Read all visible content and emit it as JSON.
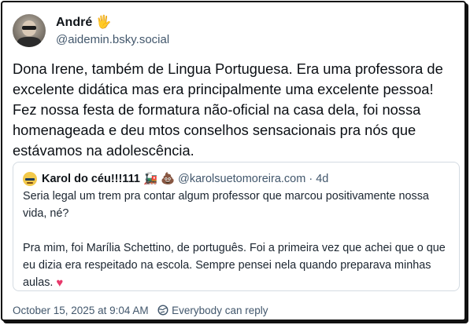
{
  "post": {
    "author_name": "André",
    "author_emoji": "🖐",
    "author_handle": "@aidemin.bsky.social",
    "text": "Dona Irene, também de Lingua Portuguesa. Era uma professora de excelente didática mas era principalmente uma excelente pessoa! Fez nossa festa de formatura não-oficial na casa dela, foi nossa homenageada e deu mtos conselhos sensacionais pra nós que estávamos na adolescência.",
    "timestamp": "October 15, 2025 at 9:04 AM",
    "reply_setting": "Everybody can reply"
  },
  "quote": {
    "author_name": "Karol do céu!!!111",
    "author_emojis": "🚂 💩",
    "author_handle": "@karolsuetomoreira.com",
    "separator": "·",
    "age": "4d",
    "text": "Seria legal um trem pra contar algum professor que marcou positivamente nossa vida, né?\n\nPra mim, foi Marília Schettino, de português. Foi a primeira vez que achei que o que eu dizia era respeitado na escola. Sempre pensei nela quando preparava minhas aulas.",
    "text_emoji": "♥"
  },
  "colors": {
    "text_primary": "#0f1419",
    "text_secondary": "#42576c",
    "border": "#d4dbe2",
    "heart": "#e8396b"
  },
  "icons": [
    "avatar-photo",
    "waving-hand-emoji",
    "train-emoji",
    "poop-emoji",
    "heart-emoji",
    "everybody-reply-icon"
  ]
}
